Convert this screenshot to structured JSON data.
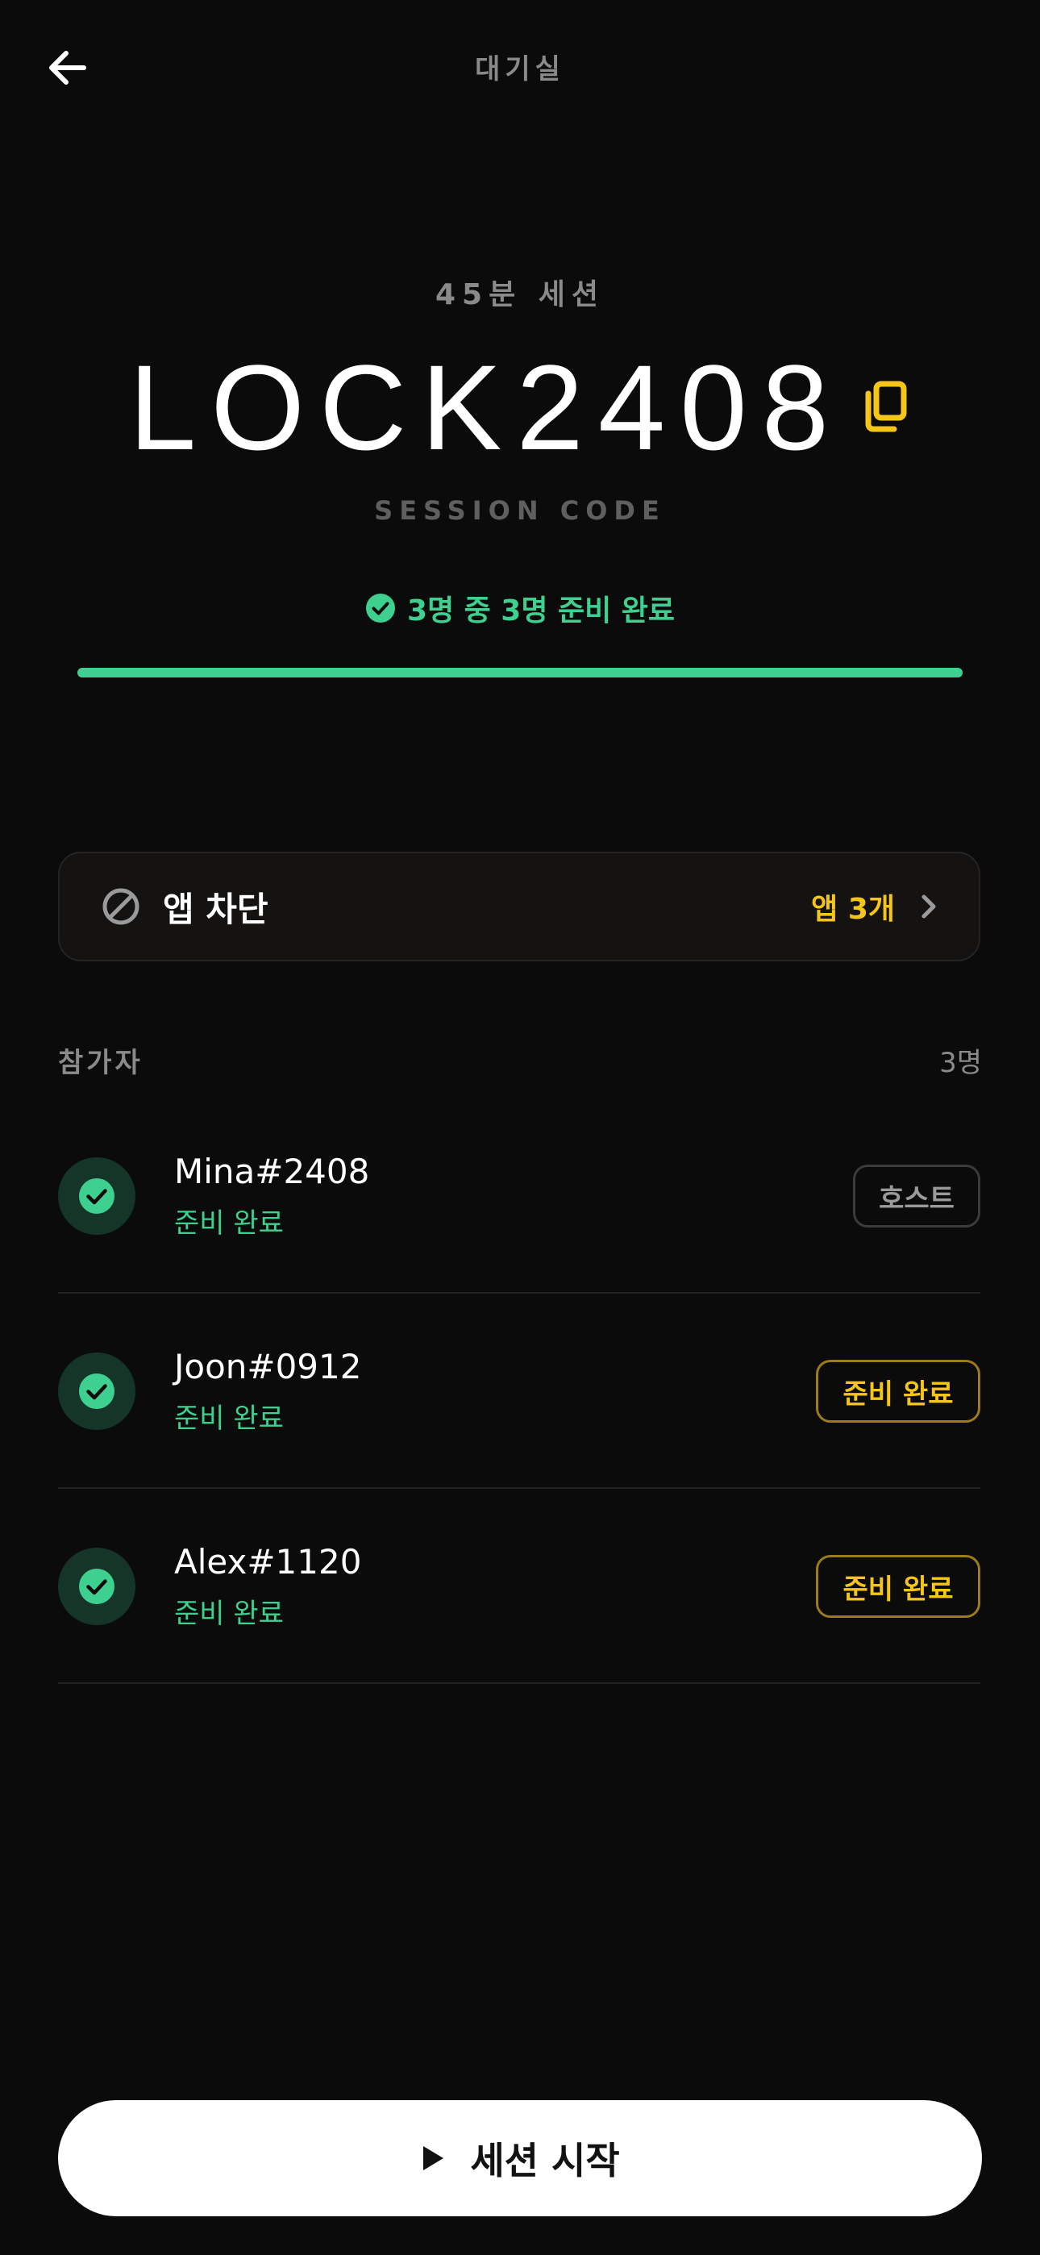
{
  "header": {
    "title": "대기실",
    "back_icon": "arrow-left-icon"
  },
  "session": {
    "duration": "45분 세션",
    "code": "LOCK2408",
    "code_caption": "SESSION CODE",
    "ready_status": "3명 중 3명 준비 완료",
    "ready_fraction": 1.0
  },
  "app_block": {
    "title": "앱 차단",
    "count": "앱 3개"
  },
  "participants": {
    "title": "참가자",
    "count": "3명",
    "items": [
      {
        "name": "Mina#2408",
        "status": "준비 완료",
        "badge": "호스트",
        "badge_type": "host"
      },
      {
        "name": "Joon#0912",
        "status": "준비 완료",
        "badge": "준비 완료",
        "badge_type": "ready"
      },
      {
        "name": "Alex#1120",
        "status": "준비 완료",
        "badge": "준비 완료",
        "badge_type": "ready"
      }
    ]
  },
  "start_button": {
    "label": "세션 시작"
  },
  "colors": {
    "background": "#0b0b0b",
    "accent_green": "#3ed08f",
    "accent_yellow": "#f5c518",
    "muted_text": "#8a8a8a"
  }
}
